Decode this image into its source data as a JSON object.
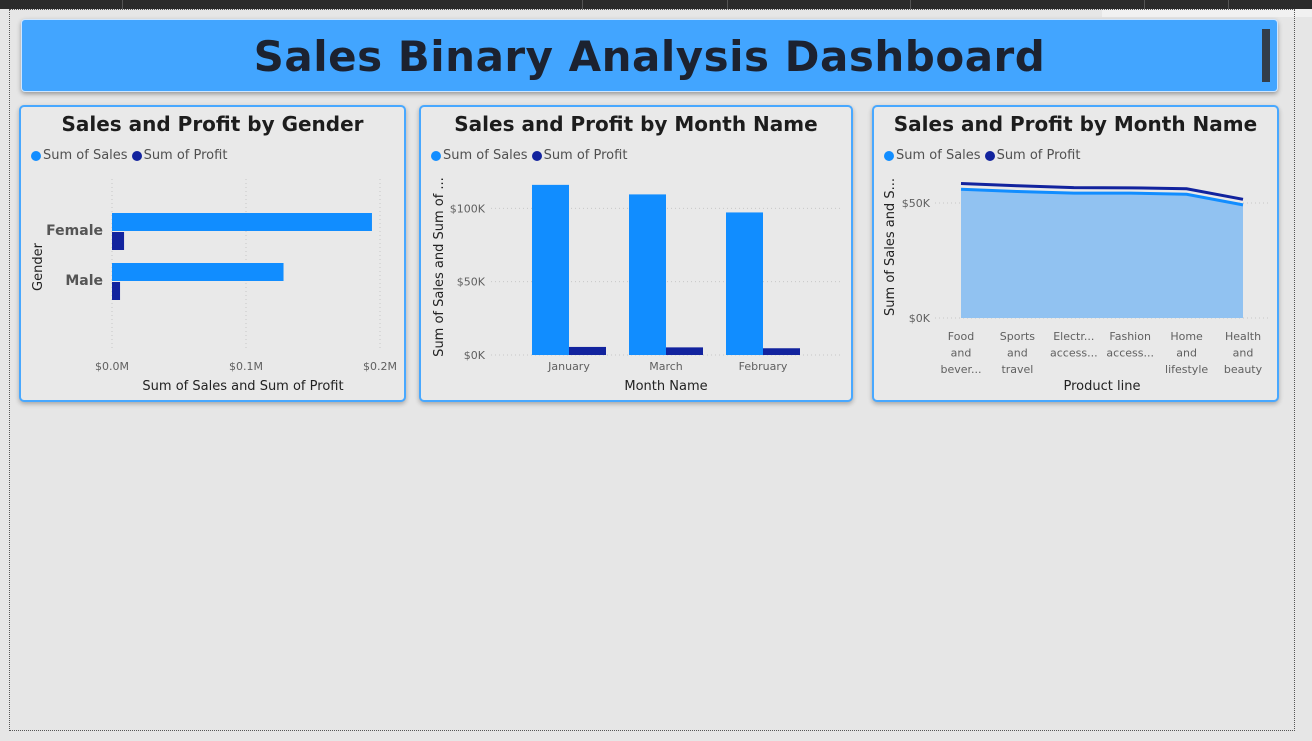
{
  "dashboard": {
    "title": "Sales Binary Analysis Dashboard"
  },
  "colors": {
    "sales": "#118dff",
    "profit": "#12239e",
    "area_fill": "#91c2f1",
    "banner": "#42a5ff"
  },
  "chart_data": [
    {
      "type": "bar",
      "orientation": "horizontal",
      "title": "Sales and Profit by Gender",
      "categories": [
        "Female",
        "Male"
      ],
      "series": [
        {
          "name": "Sum of Sales",
          "values": [
            0.194,
            0.128
          ]
        },
        {
          "name": "Sum of Profit",
          "values": [
            0.009,
            0.006
          ]
        }
      ],
      "xlabel": "Sum of Sales and Sum of Profit",
      "ylabel": "Gender",
      "xlim": [
        0,
        0.2
      ],
      "x_ticks": [
        "$0.0M",
        "$0.1M",
        "$0.2M"
      ],
      "legend": "top-left",
      "grid": true
    },
    {
      "type": "bar",
      "title": "Sales and Profit by Month Name",
      "categories": [
        "January",
        "March",
        "February"
      ],
      "series": [
        {
          "name": "Sum of Sales",
          "values": [
            116000,
            109500,
            97200
          ]
        },
        {
          "name": "Sum of Profit",
          "values": [
            5500,
            5200,
            4600
          ]
        }
      ],
      "xlabel": "Month Name",
      "ylabel": "Sum of Sales and Sum of ...",
      "ylim": [
        0,
        120000
      ],
      "y_ticks": [
        "$0K",
        "$50K",
        "$100K"
      ],
      "legend": "top-left",
      "grid": true
    },
    {
      "type": "area",
      "title": "Sales and Profit by Month Name",
      "categories": [
        "Food and bever...",
        "Sports and travel",
        "Electr... access...",
        "Fashion access...",
        "Home and lifestyle",
        "Health and beauty"
      ],
      "series": [
        {
          "name": "Sum of Sales",
          "values": [
            56000,
            55000,
            54300,
            54300,
            53800,
            49200
          ]
        },
        {
          "name": "Sum of Profit",
          "values": [
            58500,
            57500,
            56700,
            56600,
            56200,
            51600
          ]
        }
      ],
      "xlabel": "Product line",
      "ylabel": "Sum of Sales and S...",
      "ylim": [
        0,
        60000
      ],
      "y_ticks": [
        "$0K",
        "$50K"
      ],
      "legend": "top-left",
      "grid": true
    }
  ]
}
